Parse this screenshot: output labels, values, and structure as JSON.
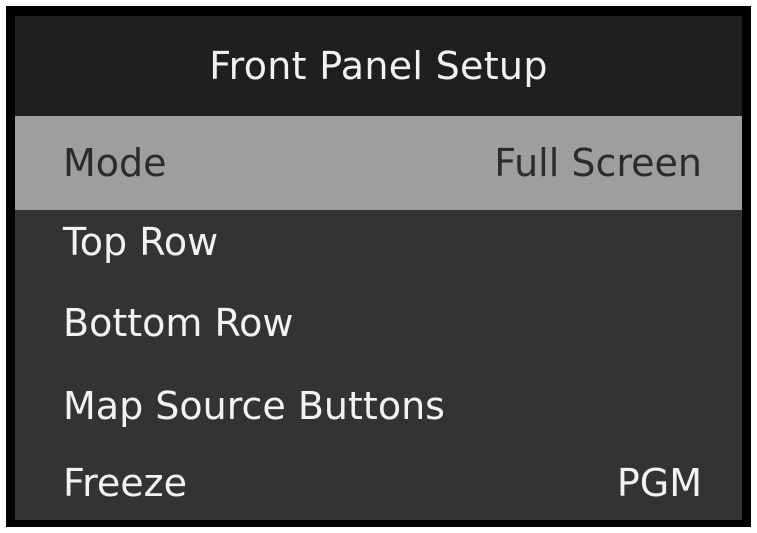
{
  "title": "Front Panel Setup",
  "menu": {
    "items": [
      {
        "label": "Mode",
        "value": "Full Screen"
      },
      {
        "label": "Top Row",
        "value": ""
      },
      {
        "label": "Bottom Row",
        "value": ""
      },
      {
        "label": "Map Source Buttons",
        "value": ""
      },
      {
        "label": "Freeze",
        "value": "PGM"
      }
    ],
    "selected_label": "Mode"
  },
  "colors": {
    "frame": "#000000",
    "title_bg": "#1f1f1f",
    "menu_bg": "#333333",
    "selected_bg": "#9e9e9e",
    "text": "#f2f2f2",
    "selected_text": "#2b2b2b"
  }
}
